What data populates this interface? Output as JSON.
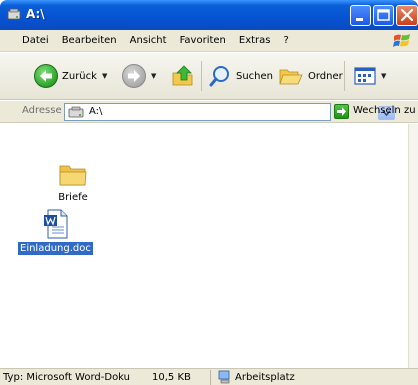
{
  "window": {
    "title": "A:\\",
    "icon": "floppy-drive-icon"
  },
  "menubar": {
    "items": [
      "Datei",
      "Bearbeiten",
      "Ansicht",
      "Favoriten",
      "Extras",
      "?"
    ]
  },
  "toolbar": {
    "back_label": "Zurück",
    "search_label": "Suchen",
    "folders_label": "Ordner"
  },
  "address": {
    "label": "Adresse",
    "value": "A:\\",
    "go_label": "Wechseln zu"
  },
  "files": [
    {
      "name": "Briefe",
      "type": "folder",
      "icon": "folder-icon",
      "selected": false
    },
    {
      "name": "Einladung.doc",
      "type": "word-document",
      "icon": "word-document-icon",
      "selected": true
    }
  ],
  "status": {
    "type_text": "Typ: Microsoft Word-Doku",
    "size_text": "10,5 KB",
    "location_text": "Arbeitsplatz"
  },
  "colors": {
    "titlebar": "#0653d2",
    "selection": "#316ac5",
    "chrome": "#ece9d8"
  }
}
